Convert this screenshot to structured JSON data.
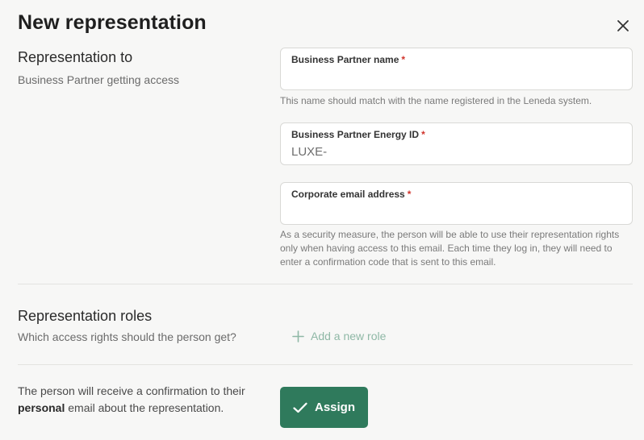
{
  "dialog": {
    "title": "New representation",
    "close_icon": "close-icon"
  },
  "representation_to": {
    "heading": "Representation to",
    "description": "Business Partner getting access",
    "fields": {
      "partner_name": {
        "label": "Business Partner name",
        "required_mark": "*",
        "value": "",
        "helper": "This name should match with the name registered in the Leneda system."
      },
      "energy_id": {
        "label": "Business Partner Energy ID",
        "required_mark": "*",
        "value": "LUXE-"
      },
      "email": {
        "label": "Corporate email address",
        "required_mark": "*",
        "value": "",
        "helper": "As a security measure, the person will be able to use their representation rights only when having access to this email. Each time they log in, they will need to enter a confirmation code that is sent to this email."
      }
    }
  },
  "roles": {
    "heading": "Representation roles",
    "description": "Which access rights should the person get?",
    "add_label": "Add a new role",
    "add_icon": "plus-icon"
  },
  "footer": {
    "note_before": "The person will receive a confirmation to their ",
    "note_bold": "personal",
    "note_after": " email about the representation.",
    "assign_label": "Assign",
    "assign_icon": "check-icon"
  },
  "colors": {
    "primary": "#2f7a5c",
    "add_role": "#8fb8a6",
    "required": "#d0342c",
    "background": "#f7f7f6"
  }
}
